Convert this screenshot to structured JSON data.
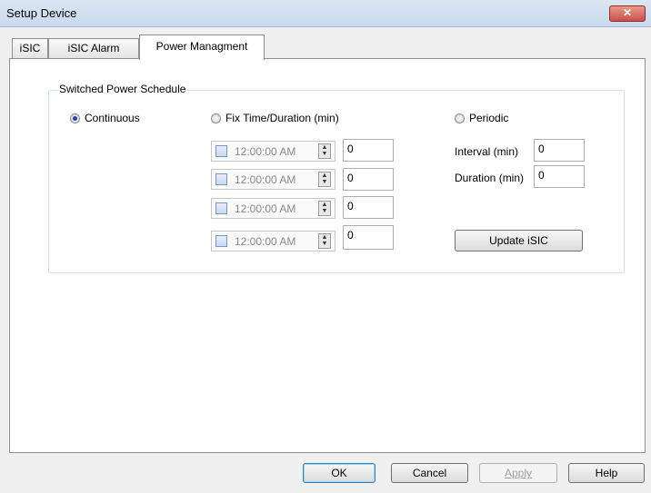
{
  "window": {
    "title": "Setup Device",
    "close_symbol": "✕"
  },
  "tabs": [
    {
      "label": "iSIC"
    },
    {
      "label": "iSIC Alarm"
    },
    {
      "label": "Power Managment"
    }
  ],
  "group": {
    "title": "Switched Power Schedule",
    "radios": {
      "continuous": {
        "label": "Continuous",
        "checked": true
      },
      "fix_time": {
        "label": "Fix Time/Duration (min)",
        "checked": false
      },
      "periodic": {
        "label": "Periodic",
        "checked": false
      }
    },
    "fix_rows": [
      {
        "time": "12:00:00 AM",
        "duration": "0"
      },
      {
        "time": "12:00:00 AM",
        "duration": "0"
      },
      {
        "time": "12:00:00 AM",
        "duration": "0"
      },
      {
        "time": "12:00:00 AM",
        "duration": "0"
      }
    ],
    "interval": {
      "label": "Interval (min)",
      "value": "0"
    },
    "duration": {
      "label": "Duration (min)",
      "value": "0"
    },
    "update_button": "Update iSIC"
  },
  "buttons": {
    "ok": "OK",
    "cancel": "Cancel",
    "apply": "Apply",
    "help": "Help"
  }
}
